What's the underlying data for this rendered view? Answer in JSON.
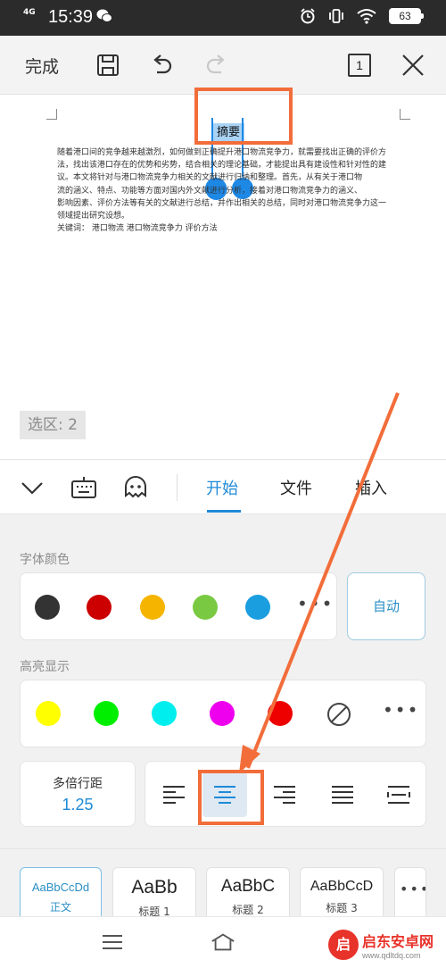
{
  "status_bar": {
    "network": "4G",
    "time": "15:39",
    "battery": "63"
  },
  "toolbar": {
    "done_label": "完成",
    "page_count": "1"
  },
  "document": {
    "title": "摘要",
    "lines": [
      "随着港口间的竞争越来越激烈，如何做到正确提升港口物流竞争力，就需要找出正确的评价方",
      "法，找出该港口存在的优势和劣势，结合相关的理论基础，才能提出具有建设性和针对性的建",
      "议。本文将针对与港口物流竞争力相关的文献进行归纳和整理。首先，从有关于港口物",
      "流的涵义、特点、功能等方面对国内外文献进行分析，接着对港口物流竞争力的涵义、",
      "影响因素、评价方法等有关的文献进行总结，并作出相关的总结，同时对港口物流竞争力这一",
      "领域提出研究设想。"
    ],
    "keywords": "关键词：  港口物流  港口物流竞争力    评价方法"
  },
  "selection_badge": "选区: 2",
  "tabs": {
    "start": "开始",
    "file": "文件",
    "insert": "插入"
  },
  "font_color": {
    "label": "字体颜色",
    "colors": [
      "#333333",
      "#cc0000",
      "#f5b400",
      "#7ac943",
      "#1a9ee0"
    ],
    "auto_label": "自动"
  },
  "highlight": {
    "label": "高亮显示",
    "colors": [
      "#ffff00",
      "#00ee00",
      "#00eeee",
      "#ee00ee",
      "#ee0000"
    ]
  },
  "line_spacing": {
    "label": "多倍行距",
    "value": "1.25"
  },
  "styles": [
    {
      "sample": "AaBbCcDd",
      "name": "正文"
    },
    {
      "sample": "AaBb",
      "name": "标题 1"
    },
    {
      "sample": "AaBbC",
      "name": "标题 2"
    },
    {
      "sample": "AaBbCcD",
      "name": "标题 3"
    }
  ],
  "watermark": {
    "title": "启东安卓网",
    "url": "www.qdltdq.com"
  },
  "annotation_color": "#f26d3a",
  "accent_color": "#1f8bd8"
}
